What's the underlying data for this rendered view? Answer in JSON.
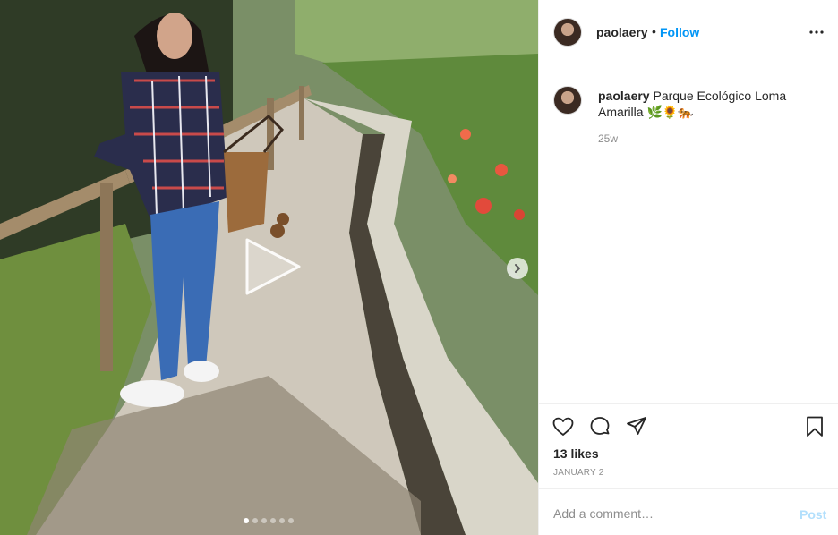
{
  "post": {
    "username": "paolaery",
    "header_separator": "•",
    "follow_label": "Follow",
    "caption_text": "Parque Ecológico Loma Amarilla",
    "caption_emojis": "🌿🌻🐅",
    "time_ago": "25w",
    "likes_text": "13 likes",
    "date_text": "JANUARY 2"
  },
  "media": {
    "type": "video",
    "carousel_count": 6,
    "carousel_active_index": 0
  },
  "icons": {
    "like": "heart-icon",
    "comment": "speech-bubble-icon",
    "share": "paper-plane-icon",
    "save": "bookmark-icon",
    "more": "ellipsis-icon",
    "play": "play-icon",
    "next": "chevron-right-icon"
  },
  "comment_box": {
    "placeholder": "Add a comment…",
    "post_label": "Post"
  },
  "colors": {
    "link_blue": "#0095f6",
    "post_disabled": "#b2dffc",
    "secondary_text": "#8e8e8e",
    "border": "#efefef"
  }
}
